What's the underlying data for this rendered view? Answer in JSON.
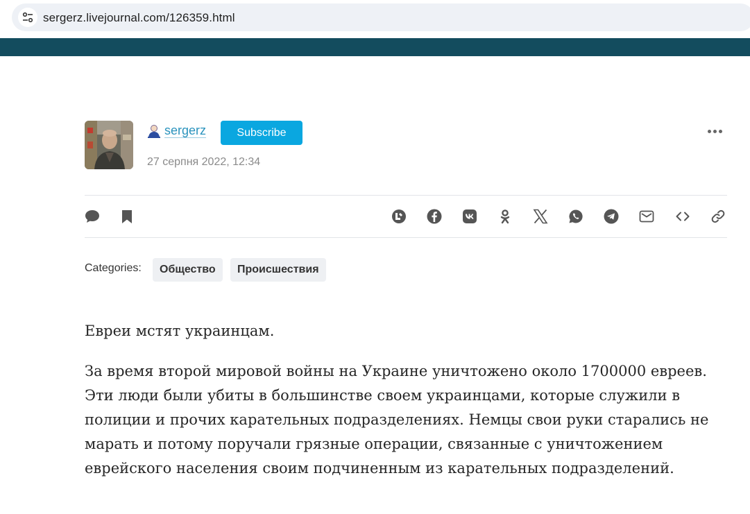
{
  "browser": {
    "url": "sergerz.livejournal.com/126359.html",
    "site_info_icon": "tune-icon"
  },
  "colors": {
    "lj_bar": "#134c5e",
    "subscribe": "#0aa7e0",
    "username": "#2a93bd"
  },
  "post": {
    "author": "sergerz",
    "subscribe_label": "Subscribe",
    "date": "27 серпня 2022, 12:34"
  },
  "actions": {
    "left": [
      "comment-icon",
      "bookmark-icon"
    ],
    "share": [
      "livejournal-repost-icon",
      "facebook-icon",
      "vk-icon",
      "odnoklassniki-icon",
      "x-icon",
      "whatsapp-icon",
      "telegram-icon",
      "email-icon",
      "embed-code-icon",
      "copy-link-icon"
    ]
  },
  "categories": {
    "label": "Categories:",
    "items": [
      "Общество",
      "Происшествия"
    ]
  },
  "article": {
    "paragraphs": [
      "Евреи мстят украинцам.",
      "За время второй мировой войны на Украине уничтожено около 1700000 евреев. Эти люди были убиты в большинстве своем украинцами, которые служили в полиции и прочих карательных подразделениях. Немцы свои руки старались не марать и потому поручали грязные операции, связанные с уничтожением еврейского населения своим подчиненным из карательных подразделений."
    ]
  }
}
